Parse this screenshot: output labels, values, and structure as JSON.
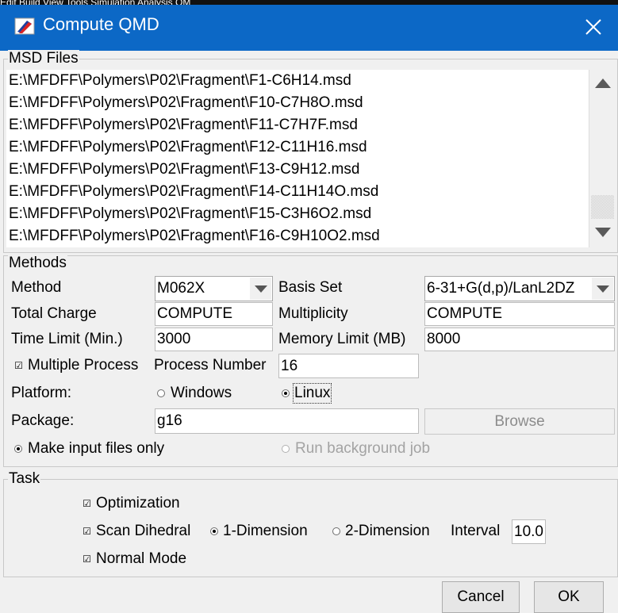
{
  "window": {
    "title": "Compute QMD",
    "menu_fragment": "Edit Build View Tools Simulation Analysis QM"
  },
  "msd_files": {
    "label": "MSD Files",
    "files": [
      "E:\\MFDFF\\Polymers\\P02\\Fragment\\F1-C6H14.msd",
      "E:\\MFDFF\\Polymers\\P02\\Fragment\\F10-C7H8O.msd",
      "E:\\MFDFF\\Polymers\\P02\\Fragment\\F11-C7H7F.msd",
      "E:\\MFDFF\\Polymers\\P02\\Fragment\\F12-C11H16.msd",
      "E:\\MFDFF\\Polymers\\P02\\Fragment\\F13-C9H12.msd",
      "E:\\MFDFF\\Polymers\\P02\\Fragment\\F14-C11H14O.msd",
      "E:\\MFDFF\\Polymers\\P02\\Fragment\\F15-C3H6O2.msd",
      "E:\\MFDFF\\Polymers\\P02\\Fragment\\F16-C9H10O2.msd"
    ]
  },
  "methods": {
    "label": "Methods",
    "method_label": "Method",
    "method_value": "M062X",
    "basis_label": "Basis Set",
    "basis_value": "6-31+G(d,p)/LanL2DZ",
    "charge_label": "Total Charge",
    "charge_value": "COMPUTE",
    "mult_label": "Multiplicity",
    "mult_value": "COMPUTE",
    "time_label": "Time Limit (Min.)",
    "time_value": "3000",
    "memory_label": "Memory Limit (MB)",
    "memory_value": "8000",
    "multiproc_label": "Multiple Process",
    "procnum_label": "Process Number",
    "procnum_value": "16",
    "platform_label": "Platform:",
    "windows_label": "Windows",
    "linux_label": "Linux",
    "package_label": "Package:",
    "package_value": "g16",
    "browse_label": "Browse",
    "make_input_label": "Make input files only",
    "run_bg_label": "Run background job"
  },
  "task": {
    "label": "Task",
    "optimization_label": "Optimization",
    "scan_label": "Scan Dihedral",
    "dim1_label": "1-Dimension",
    "dim2_label": "2-Dimension",
    "interval_label": "Interval",
    "interval_value": "10.0",
    "normal_mode_label": "Normal Mode"
  },
  "buttons": {
    "cancel": "Cancel",
    "ok": "OK"
  }
}
